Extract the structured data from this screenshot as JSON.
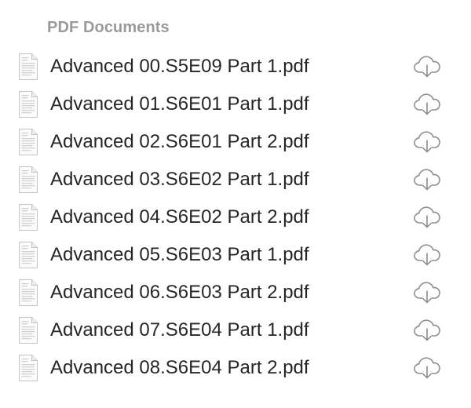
{
  "section": {
    "title": "PDF Documents"
  },
  "icons": {
    "file": "pdf-document-icon",
    "action": "cloud-download-icon"
  },
  "colors": {
    "header": "#9a9a9a",
    "text": "#262626",
    "icon": "#8e8e8e"
  },
  "files": [
    {
      "name": "Advanced 00.S5E09 Part 1.pdf"
    },
    {
      "name": "Advanced 01.S6E01 Part 1.pdf"
    },
    {
      "name": "Advanced 02.S6E01 Part 2.pdf"
    },
    {
      "name": "Advanced 03.S6E02 Part 1.pdf"
    },
    {
      "name": "Advanced 04.S6E02 Part 2.pdf"
    },
    {
      "name": "Advanced 05.S6E03 Part 1.pdf"
    },
    {
      "name": "Advanced 06.S6E03 Part 2.pdf"
    },
    {
      "name": "Advanced 07.S6E04 Part 1.pdf"
    },
    {
      "name": "Advanced 08.S6E04 Part 2.pdf"
    }
  ]
}
